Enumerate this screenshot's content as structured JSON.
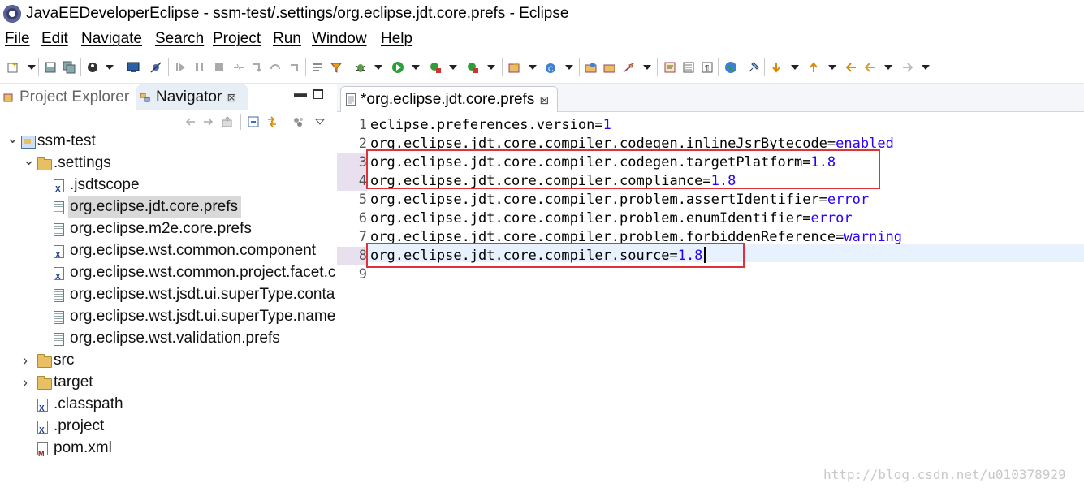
{
  "window": {
    "title": "JavaEEDeveloperEclipse - ssm-test/.settings/org.eclipse.jdt.core.prefs - Eclipse"
  },
  "menu": [
    "File",
    "Edit",
    "Navigate",
    "Search",
    "Project",
    "Run",
    "Window",
    "Help"
  ],
  "left_view": {
    "tabs": [
      {
        "label": "Project Explorer",
        "active": false
      },
      {
        "label": "Navigator",
        "active": true
      }
    ],
    "close_glyph": "⊠"
  },
  "tree": [
    {
      "label": "ssm-test",
      "level": 0,
      "kind": "project",
      "expanded": true
    },
    {
      "label": ".settings",
      "level": 1,
      "kind": "folder",
      "expanded": true
    },
    {
      "label": ".jsdtscope",
      "level": 2,
      "kind": "xml-file"
    },
    {
      "label": "org.eclipse.jdt.core.prefs",
      "level": 2,
      "kind": "text-file",
      "selected": true
    },
    {
      "label": "org.eclipse.m2e.core.prefs",
      "level": 2,
      "kind": "text-file"
    },
    {
      "label": "org.eclipse.wst.common.component",
      "level": 2,
      "kind": "xml-file"
    },
    {
      "label": "org.eclipse.wst.common.project.facet.core.xml",
      "level": 2,
      "kind": "xml-file"
    },
    {
      "label": "org.eclipse.wst.jsdt.ui.superType.container",
      "level": 2,
      "kind": "text-file"
    },
    {
      "label": "org.eclipse.wst.jsdt.ui.superType.name",
      "level": 2,
      "kind": "text-file"
    },
    {
      "label": "org.eclipse.wst.validation.prefs",
      "level": 2,
      "kind": "text-file"
    },
    {
      "label": "src",
      "level": 1,
      "kind": "folder",
      "expanded": false
    },
    {
      "label": "target",
      "level": 1,
      "kind": "folder",
      "expanded": false
    },
    {
      "label": ".classpath",
      "level": 1,
      "kind": "xml-file"
    },
    {
      "label": ".project",
      "level": 1,
      "kind": "xml-file"
    },
    {
      "label": "pom.xml",
      "level": 1,
      "kind": "maven-file"
    }
  ],
  "editor": {
    "tab_label": "*org.eclipse.jdt.core.prefs",
    "lines": [
      {
        "n": "1",
        "key": "eclipse.preferences.version=",
        "value": "1"
      },
      {
        "n": "2",
        "key": "org.eclipse.jdt.core.compiler.codegen.inlineJsrBytecode=",
        "value": "enabled"
      },
      {
        "n": "3",
        "key": "org.eclipse.jdt.core.compiler.codegen.targetPlatform=",
        "value": "1.8"
      },
      {
        "n": "4",
        "key": "org.eclipse.jdt.core.compiler.compliance=",
        "value": "1.8"
      },
      {
        "n": "5",
        "key": "org.eclipse.jdt.core.compiler.problem.assertIdentifier=",
        "value": "error"
      },
      {
        "n": "6",
        "key": "org.eclipse.jdt.core.compiler.problem.enumIdentifier=",
        "value": "error"
      },
      {
        "n": "7",
        "key": "org.eclipse.jdt.core.compiler.problem.forbiddenReference=",
        "value": "warning"
      },
      {
        "n": "8",
        "key": "org.eclipse.jdt.core.compiler.source=",
        "value": "1.8"
      },
      {
        "n": "9",
        "key": "",
        "value": ""
      }
    ],
    "current_line": 8
  },
  "watermark": "http://blog.csdn.net/u010378929",
  "colors": {
    "value_text": "#2a00ff",
    "highlight_box": "#e0323a",
    "selection": "#d9d9d9",
    "current_line": "#e8f2fe"
  }
}
